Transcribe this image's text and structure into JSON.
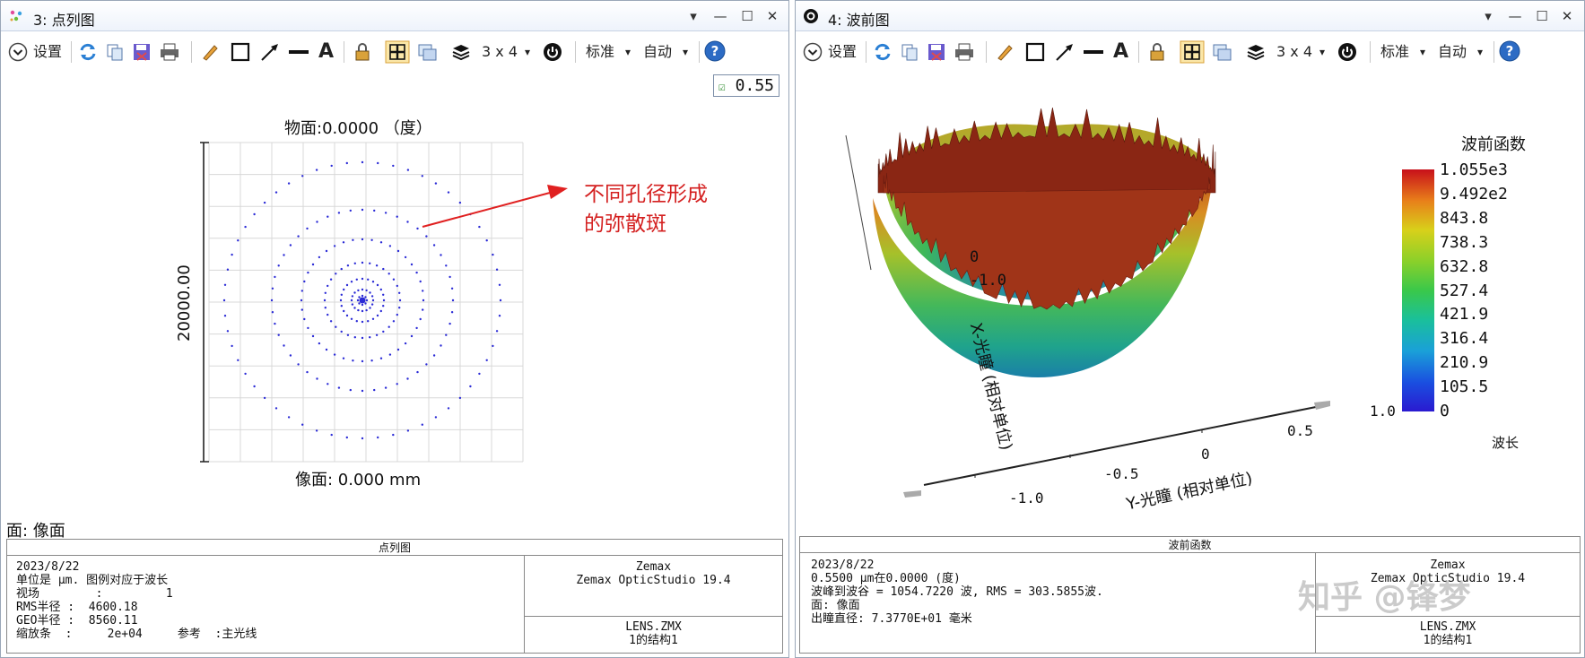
{
  "left": {
    "title": "3: 点列图",
    "toolbar": {
      "settings": "设置",
      "grid": "3 x 4",
      "standard": "标准",
      "auto": "自动"
    },
    "wavelength_check": "0.55",
    "plot_title": "物面:0.0000 （度）",
    "ylabel": "20000.00",
    "xlabel": "像面: 0.000 mm",
    "annotation_line1": "不同孔径形成",
    "annotation_line2": "的弥散斑",
    "surface_label": "面: 像面",
    "panel": {
      "header": "点列图",
      "lines": [
        "2023/8/22",
        "单位是 μm. 图例对应于波长",
        "视场        :         1",
        "RMS半径 :  4600.18",
        "GEO半径 :  8560.11",
        "缩放条  :     2e+04     参考  :主光线"
      ],
      "vendor": "Zemax",
      "product": "Zemax OpticStudio 19.4",
      "file": "LENS.ZMX",
      "config": "1的结构1"
    }
  },
  "right": {
    "title": "4: 波前图",
    "toolbar": {
      "settings": "设置",
      "grid": "3 x 4",
      "standard": "标准",
      "auto": "自动"
    },
    "colorbar_title": "波前函数",
    "colorbar_ticks": [
      "1.055e3",
      "9.492e2",
      "843.8",
      "738.3",
      "632.8",
      "527.4",
      "421.9",
      "316.4",
      "210.9",
      "105.5",
      "0"
    ],
    "colorbar_unit": "波长",
    "y_axis_label": "Y-光瞳 (相对单位)",
    "x_axis_label": "X-光瞳 (相对单位)",
    "y_ticks": [
      "-1.0",
      "-0.5",
      "0",
      "0.5",
      "1.0"
    ],
    "x_ticks": [
      "0",
      "-1.0"
    ],
    "panel": {
      "header": "波前函数",
      "lines": [
        "2023/8/22",
        "0.5500 µm在0.0000 (度)",
        "波峰到波谷 = 1054.7220 波, RMS = 303.5855波.",
        "面: 像面",
        "出瞳直径: 7.3770E+01 毫米"
      ],
      "vendor": "Zemax",
      "product": "Zemax OpticStudio 19.4",
      "file": "LENS.ZMX",
      "config": "1的结构1"
    },
    "watermark": "知乎 @锋梦"
  },
  "colors": {
    "spot": "#2b2bd6",
    "arrow": "#e02020",
    "annotation": "#d42020",
    "grid": "#d8d8d8",
    "title_bar": "#eef3fb"
  }
}
